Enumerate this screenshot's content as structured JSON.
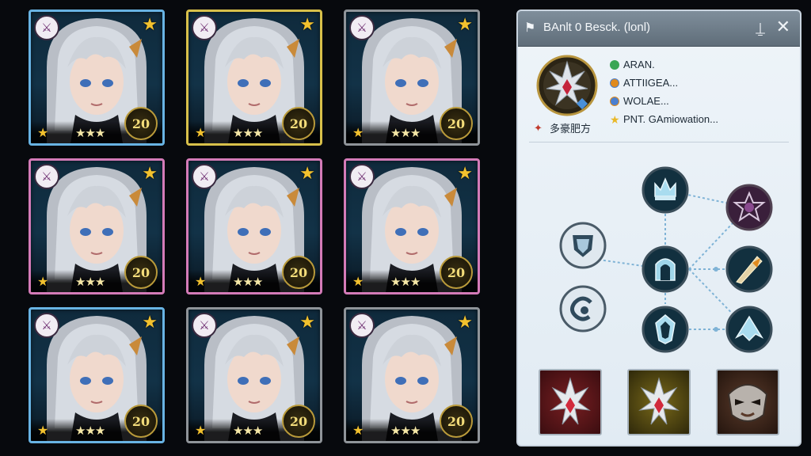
{
  "panel": {
    "title": "BAnlt 0 Besck. (lonl)",
    "icons": {
      "header": "flag-icon",
      "pin": "pin-icon",
      "close": "close-icon"
    },
    "stats": [
      {
        "label": "ARAN.",
        "icon": "green-gem-icon",
        "color": "#3aa655"
      },
      {
        "label": "ATTIIGEA...",
        "icon": "orange-orb-icon",
        "color": "#e08a1e"
      },
      {
        "label": "WOLAE...",
        "icon": "blue-orb-icon",
        "color": "#4a7fd0"
      },
      {
        "label": "PNT. GAmiowation...",
        "icon": "star-icon",
        "color": "#e9b827"
      }
    ],
    "faction": "多豪肥方",
    "skills": [
      {
        "name": "skill-node-crown",
        "theme": "blue"
      },
      {
        "name": "skill-node-dark-sigil",
        "theme": "purple"
      },
      {
        "name": "skill-node-shield",
        "theme": "blue"
      },
      {
        "name": "skill-node-gate",
        "theme": "blue"
      },
      {
        "name": "skill-node-blade",
        "theme": "orange"
      },
      {
        "name": "skill-node-crest",
        "theme": "blue"
      },
      {
        "name": "skill-node-wing",
        "theme": "blue"
      },
      {
        "name": "skill-node-swirl",
        "theme": "blue"
      }
    ],
    "items": [
      {
        "name": "red-crest-item",
        "theme": "red"
      },
      {
        "name": "gold-crest-item",
        "theme": "gold"
      },
      {
        "name": "mask-item",
        "theme": "brown"
      }
    ]
  },
  "cards": [
    {
      "frame": "blue",
      "rank_icon": "⚔",
      "level": "20",
      "rating": "★★★"
    },
    {
      "frame": "gold",
      "rank_icon": "⚔",
      "level": "20",
      "rating": "★★★"
    },
    {
      "frame": "silver",
      "rank_icon": "⚔",
      "level": "20",
      "rating": "★★★"
    },
    {
      "frame": "pink",
      "rank_icon": "⚔",
      "level": "20",
      "rating": "★★★"
    },
    {
      "frame": "pink",
      "rank_icon": "⚔",
      "level": "20",
      "rating": "★★★"
    },
    {
      "frame": "pink",
      "rank_icon": "⚔",
      "level": "20",
      "rating": "★★★"
    },
    {
      "frame": "blue",
      "rank_icon": "⚔",
      "level": "20",
      "rating": "★★★"
    },
    {
      "frame": "silver",
      "rank_icon": "⚔",
      "level": "20",
      "rating": "★★★"
    },
    {
      "frame": "silver",
      "rank_icon": "⚔",
      "level": "20",
      "rating": "★★★"
    }
  ]
}
